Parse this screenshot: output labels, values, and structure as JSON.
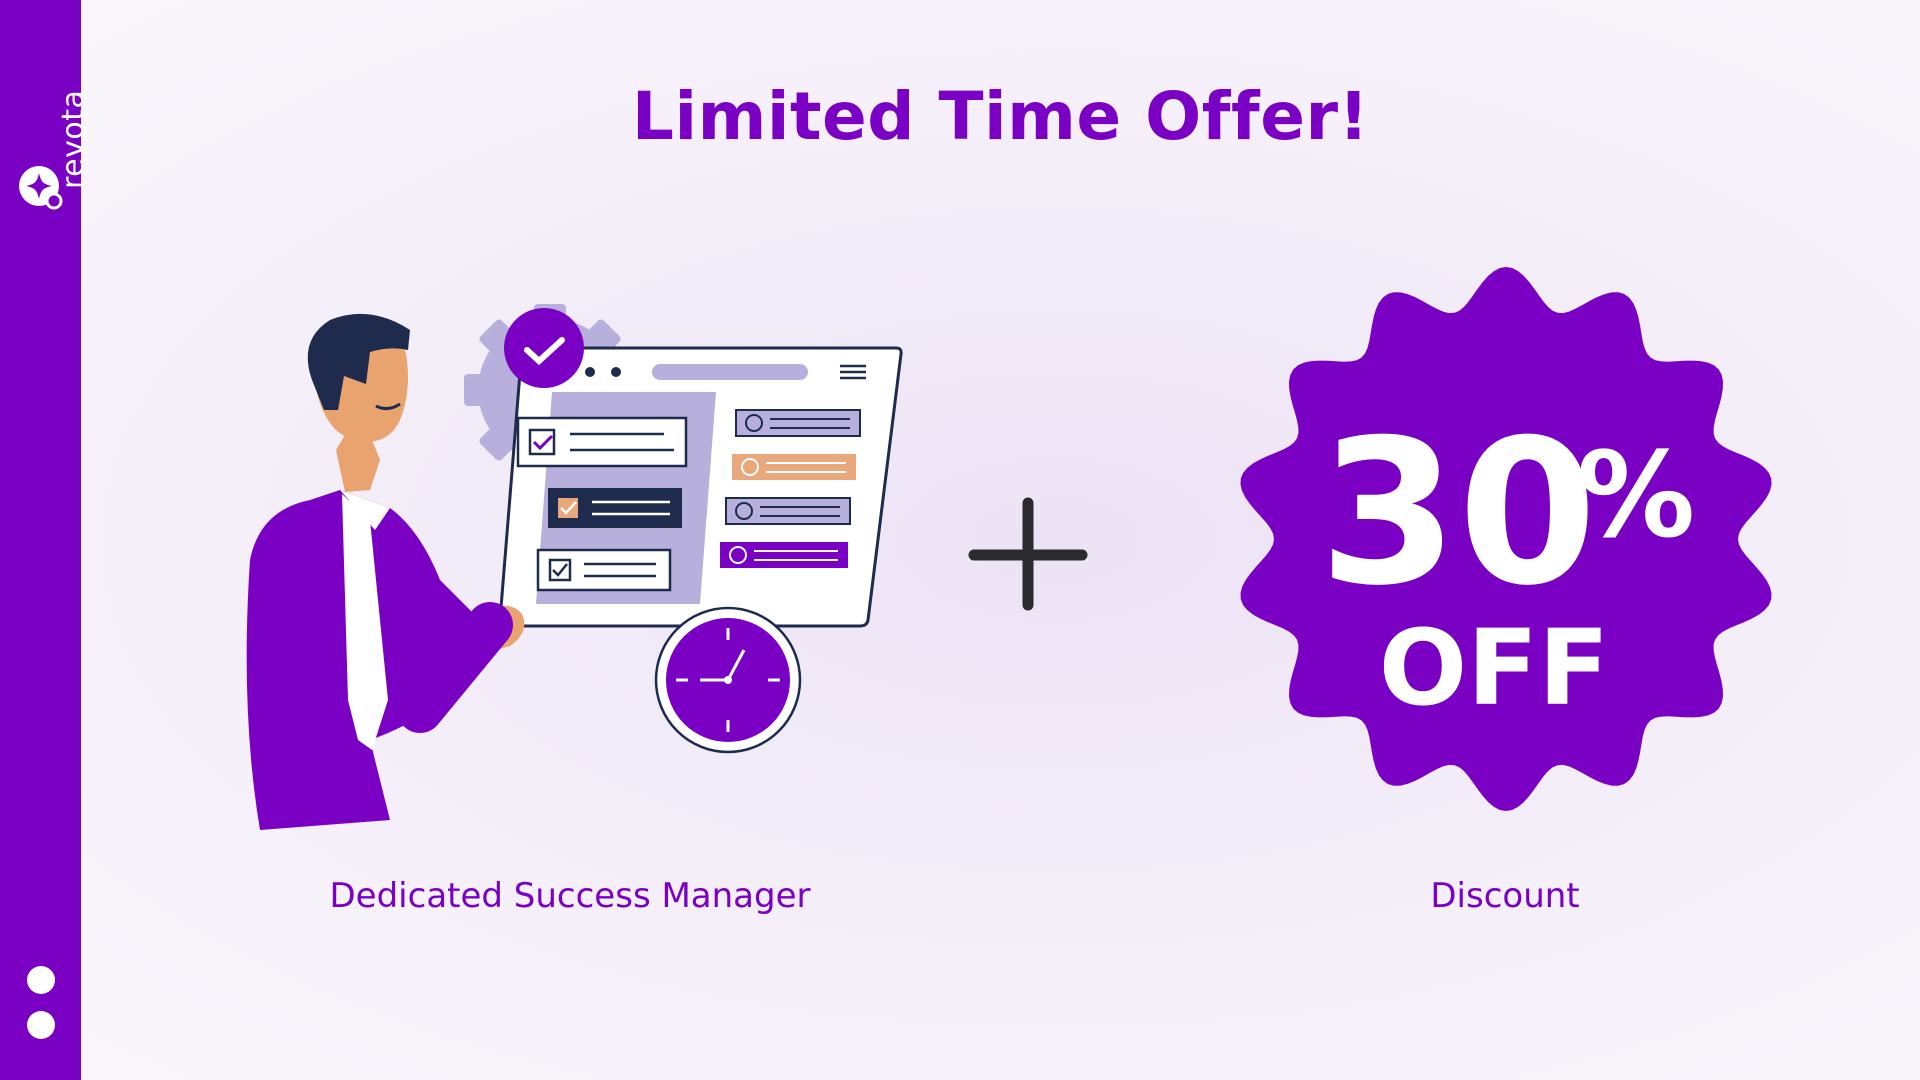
{
  "brand": {
    "name": "revota",
    "icon": "revota-logo-icon"
  },
  "sidebar": {
    "nav_dots": [
      {
        "icon": "nav-dot-icon"
      },
      {
        "icon": "nav-dot-icon"
      }
    ]
  },
  "slide": {
    "title": "Limited Time Offer!",
    "left_caption": "Dedicated Success Manager",
    "right_caption": "Discount",
    "badge": {
      "value": "30",
      "percent": "%",
      "off": "OFF"
    },
    "operator_icon": "plus-icon"
  },
  "colors": {
    "accent": "#7a00c4",
    "sidebar": "#7a00c4",
    "navy": "#1f2b4d",
    "skin": "#e8a36f",
    "lavender": "#b7b0dc",
    "orange": "#e8a87c",
    "plus": "#2b2b2e"
  }
}
